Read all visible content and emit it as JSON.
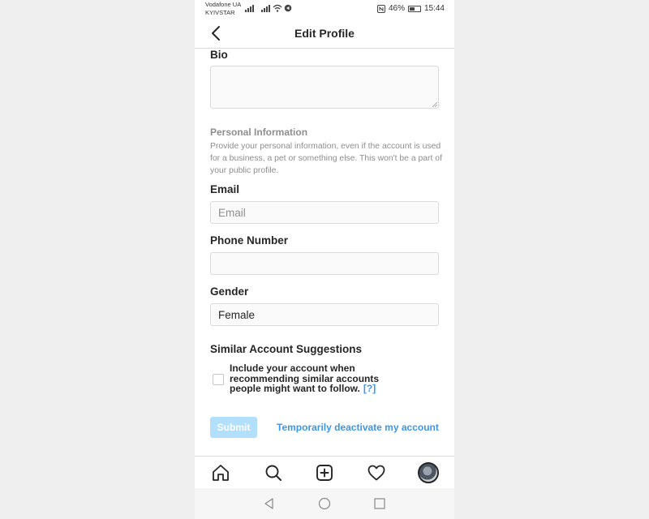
{
  "status_bar": {
    "carrier_line1": "Vodafone UA",
    "carrier_line2": "KYIVSTAR",
    "battery_percent": "46%",
    "time": "15:44"
  },
  "header": {
    "title": "Edit Profile"
  },
  "form": {
    "bio_label": "Bio",
    "bio_value": "",
    "personal_info": {
      "title": "Personal Information",
      "description": "Provide your personal information, even if the account is used for a business, a pet or something else. This won't be a part of your public profile."
    },
    "email_label": "Email",
    "email_placeholder": "Email",
    "email_value": "",
    "phone_label": "Phone Number",
    "phone_value": "",
    "gender_label": "Gender",
    "gender_value": "Female",
    "similar_title": "Similar Account Suggestions",
    "similar_checkbox_text": "Include your account when recommending similar accounts people might want to follow.",
    "similar_help": "[?]",
    "similar_checked": false,
    "submit_label": "Submit",
    "deactivate_label": "Temporarily deactivate my account"
  },
  "bottom_nav": [
    "home-icon",
    "search-icon",
    "new-post-icon",
    "activity-heart-icon",
    "profile-avatar"
  ],
  "colors": {
    "link_blue": "#3897f0",
    "submit_disabled": "#b2dffc",
    "text_dark": "#262626",
    "text_gray": "#8e8e8e",
    "border": "#dbdbdb"
  }
}
